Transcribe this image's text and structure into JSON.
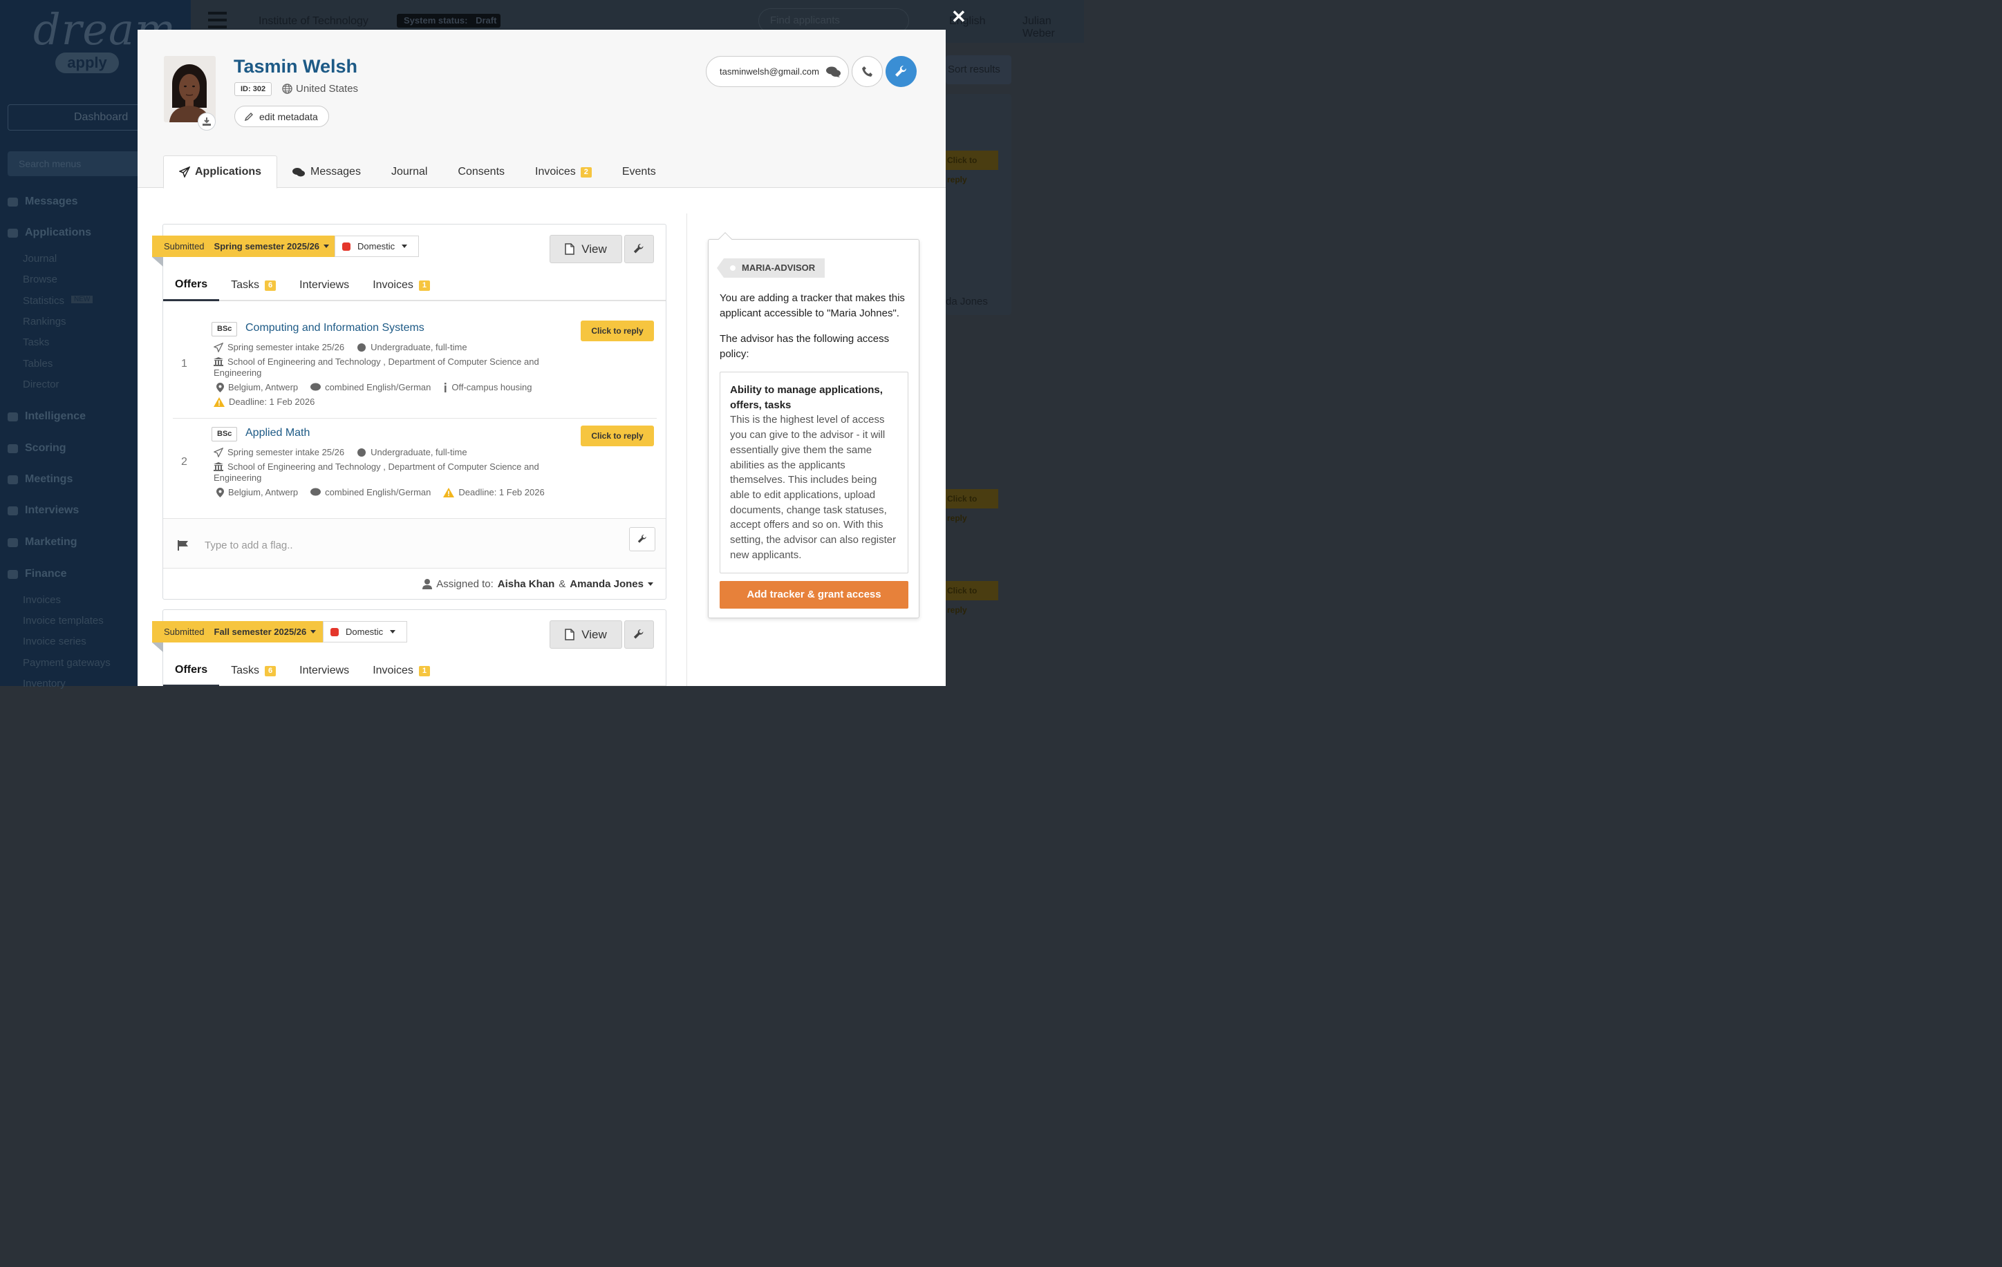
{
  "background": {
    "logo_top": "dream",
    "logo_bottom": "apply",
    "dashboard": "Dashboard",
    "search_menus_placeholder": "Search menus",
    "institution": "Institute of Technology",
    "system_status": "System status:",
    "system_status_value": "Draft",
    "find_placeholder": "Find applicants",
    "language": "English",
    "user": "Julian Weber",
    "sort_results": "Sort results",
    "bg_reply_1": "Click to reply",
    "bg_reply_2": "Click to reply",
    "bg_reply_3": "Click to reply",
    "bg_assigned": "da Jones",
    "nav": [
      {
        "label": "Messages"
      },
      {
        "label": "Applications"
      },
      {
        "label": "Intelligence"
      },
      {
        "label": "Scoring"
      },
      {
        "label": "Meetings"
      },
      {
        "label": "Interviews"
      },
      {
        "label": "Marketing"
      },
      {
        "label": "Finance"
      }
    ],
    "subnav_applications": [
      "Journal",
      "Browse",
      "Statistics",
      "Rankings",
      "Tasks",
      "Tables",
      "Director"
    ],
    "statistics_badge": "NEW",
    "subnav_finance": [
      "Invoices",
      "Invoice templates",
      "Invoice series",
      "Payment gateways",
      "Inventory"
    ]
  },
  "applicant": {
    "name": "Tasmin Welsh",
    "id_label": "ID: 302",
    "country": "United States",
    "edit_metadata": "edit metadata",
    "email": "tasminwelsh@gmail.com"
  },
  "tabs": [
    {
      "label": "Applications"
    },
    {
      "label": "Messages"
    },
    {
      "label": "Journal"
    },
    {
      "label": "Consents"
    },
    {
      "label": "Invoices",
      "count": "2"
    },
    {
      "label": "Events"
    }
  ],
  "applications": [
    {
      "status": "Submitted",
      "semester": "Spring semester 2025/26",
      "category": "Domestic",
      "view_label": "View",
      "subtabs": {
        "offers": "Offers",
        "tasks": "Tasks",
        "tasks_count": "6",
        "interviews": "Interviews",
        "invoices": "Invoices",
        "invoices_count": "1"
      },
      "offers": [
        {
          "num": "1",
          "degree": "BSc",
          "title": "Computing and Information Systems",
          "intake": "Spring semester intake 25/26",
          "level": "Undergraduate, full-time",
          "school": "School of Engineering and Technology , Department of Computer Science and",
          "school_cont": "Engineering",
          "location": "Belgium, Antwerp",
          "language": "combined English/German",
          "extra": "Off-campus housing",
          "deadline": "Deadline: 1 Feb 2026",
          "reply": "Click to reply"
        },
        {
          "num": "2",
          "degree": "BSc",
          "title": "Applied Math",
          "intake": "Spring semester intake 25/26",
          "level": "Undergraduate, full-time",
          "school": "School of Engineering and Technology , Department of Computer Science and",
          "school_cont": "Engineering",
          "location": "Belgium, Antwerp",
          "language": "combined English/German",
          "deadline": "Deadline: 1 Feb 2026",
          "reply": "Click to reply"
        }
      ],
      "flag_placeholder": "Type to add a flag..",
      "assigned_label": "Assigned to:",
      "assignee_1": "Aisha Khan",
      "assign_amp": "&",
      "assignee_2": "Amanda Jones"
    },
    {
      "status": "Submitted",
      "semester": "Fall semester 2025/26",
      "category": "Domestic",
      "view_label": "View",
      "subtabs": {
        "offers": "Offers",
        "tasks": "Tasks",
        "tasks_count": "6",
        "interviews": "Interviews",
        "invoices": "Invoices",
        "invoices_count": "1"
      }
    }
  ],
  "tracker": {
    "tag": "MARIA-ADVISOR",
    "intro": "You are adding a tracker that makes this applicant accessible to \"Maria Johnes\".",
    "policy_intro": "The advisor has the following access policy:",
    "policy_title": "Ability to manage applications, offers, tasks",
    "policy_body": "This is the highest level of access you can give to the advisor - it will essentially give them the same abilities as the applicants themselves. This includes being able to edit applications, upload documents, change task statuses, accept offers and so on. With this setting, the advisor can also register new applicants.",
    "button": "Add tracker & grant access"
  },
  "colors": {
    "accent_blue": "#3a8ed4",
    "name_blue": "#1d5a86",
    "yellow": "#f6c53f",
    "orange": "#e7813a",
    "domestic_red": "#e4362b"
  },
  "icons": [
    "close-icon",
    "download-icon",
    "globe-icon",
    "pencil-icon",
    "chat-icon",
    "phone-icon",
    "wrench-icon",
    "paper-plane-icon",
    "comments-icon",
    "document-icon",
    "caret-down-icon",
    "send-icon",
    "certificate-icon",
    "bank-icon",
    "map-marker-icon",
    "speech-icon",
    "info-icon",
    "warning-icon",
    "flag-icon",
    "user-icon"
  ]
}
